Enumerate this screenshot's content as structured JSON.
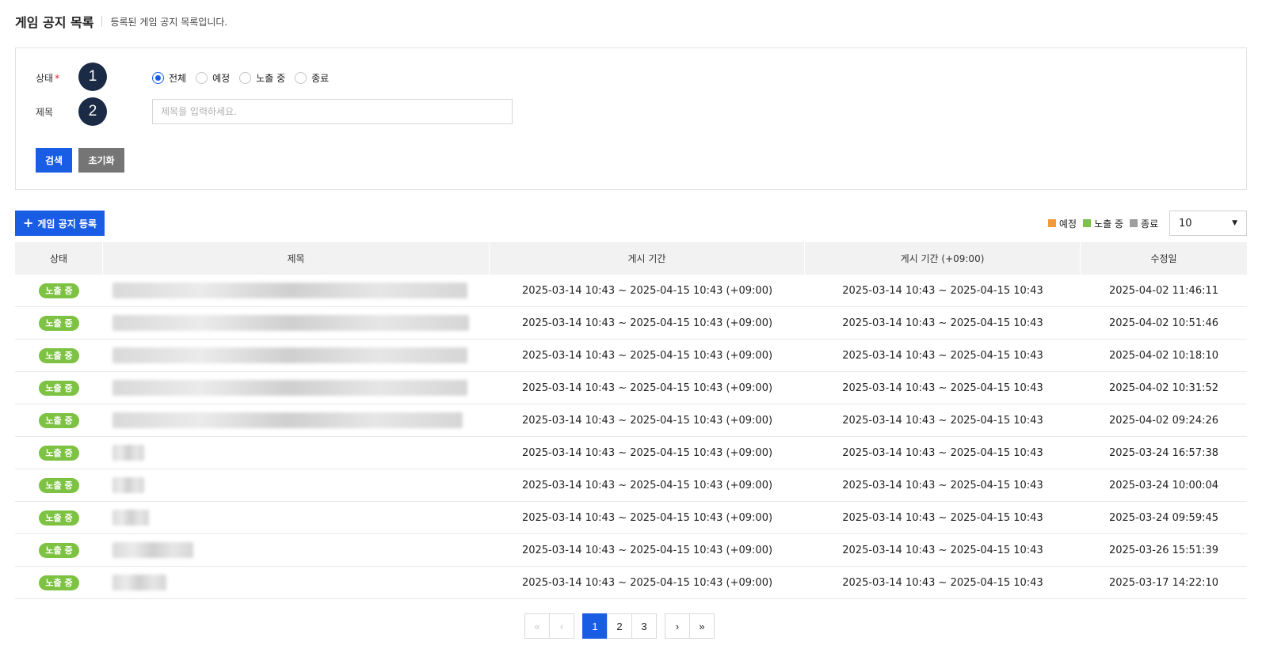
{
  "header": {
    "title": "게임 공지 목록",
    "subtitle": "등록된 게임 공지 목록입니다."
  },
  "search": {
    "status_label": "상태",
    "required_mark": "*",
    "title_label": "제목",
    "step_badges": [
      "1",
      "2"
    ],
    "status_options": [
      {
        "label": "전체",
        "checked": true
      },
      {
        "label": "예정",
        "checked": false
      },
      {
        "label": "노출 중",
        "checked": false
      },
      {
        "label": "종료",
        "checked": false
      }
    ],
    "title_placeholder": "제목을 입력하세요.",
    "title_value": "",
    "search_button": "검색",
    "reset_button": "초기화"
  },
  "toolbar": {
    "register_button": "게임 공지 등록",
    "register_icon": "plus-icon",
    "legend": [
      {
        "label": "예정",
        "color": "#f39a3a"
      },
      {
        "label": "노출 중",
        "color": "#7dc242"
      },
      {
        "label": "종료",
        "color": "#9e9e9e"
      }
    ],
    "page_size": "10",
    "page_size_icon": "caret-down-icon"
  },
  "table": {
    "columns": [
      "상태",
      "제목",
      "게시 기간",
      "게시 기간 (+09:00)",
      "수정일"
    ],
    "status_color": "#7dc242",
    "rows": [
      {
        "status": "노출 중",
        "period": "2025-03-14 10:43 ~ 2025-04-15 10:43 (+09:00)",
        "period_kst": "2025-03-14 10:43 ~ 2025-04-15 10:43",
        "modified": "2025-04-02 11:46:11"
      },
      {
        "status": "노출 중",
        "period": "2025-03-14 10:43 ~ 2025-04-15 10:43 (+09:00)",
        "period_kst": "2025-03-14 10:43 ~ 2025-04-15 10:43",
        "modified": "2025-04-02 10:51:46"
      },
      {
        "status": "노출 중",
        "period": "2025-03-14 10:43 ~ 2025-04-15 10:43 (+09:00)",
        "period_kst": "2025-03-14 10:43 ~ 2025-04-15 10:43",
        "modified": "2025-04-02 10:18:10"
      },
      {
        "status": "노출 중",
        "period": "2025-03-14 10:43 ~ 2025-04-15 10:43 (+09:00)",
        "period_kst": "2025-03-14 10:43 ~ 2025-04-15 10:43",
        "modified": "2025-04-02 10:31:52"
      },
      {
        "status": "노출 중",
        "period": "2025-03-14 10:43 ~ 2025-04-15 10:43 (+09:00)",
        "period_kst": "2025-03-14 10:43 ~ 2025-04-15 10:43",
        "modified": "2025-04-02 09:24:26"
      },
      {
        "status": "노출 중",
        "period": "2025-03-14 10:43 ~ 2025-04-15 10:43 (+09:00)",
        "period_kst": "2025-03-14 10:43 ~ 2025-04-15 10:43",
        "modified": "2025-03-24 16:57:38"
      },
      {
        "status": "노출 중",
        "period": "2025-03-14 10:43 ~ 2025-04-15 10:43 (+09:00)",
        "period_kst": "2025-03-14 10:43 ~ 2025-04-15 10:43",
        "modified": "2025-03-24 10:00:04"
      },
      {
        "status": "노출 중",
        "period": "2025-03-14 10:43 ~ 2025-04-15 10:43 (+09:00)",
        "period_kst": "2025-03-14 10:43 ~ 2025-04-15 10:43",
        "modified": "2025-03-24 09:59:45"
      },
      {
        "status": "노출 중",
        "period": "2025-03-14 10:43 ~ 2025-04-15 10:43 (+09:00)",
        "period_kst": "2025-03-14 10:43 ~ 2025-04-15 10:43",
        "modified": "2025-03-26 15:51:39"
      },
      {
        "status": "노출 중",
        "period": "2025-03-14 10:43 ~ 2025-04-15 10:43 (+09:00)",
        "period_kst": "2025-03-14 10:43 ~ 2025-04-15 10:43",
        "modified": "2025-03-17 14:22:10"
      }
    ]
  },
  "pagination": {
    "first_icon": "double-chevron-left-icon",
    "prev_icon": "chevron-left-icon",
    "next_icon": "chevron-right-icon",
    "last_icon": "double-chevron-right-icon",
    "pages": [
      "1",
      "2",
      "3"
    ],
    "current": "1"
  }
}
